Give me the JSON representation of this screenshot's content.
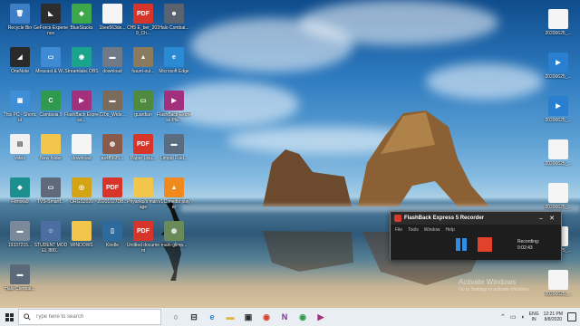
{
  "desktop": {
    "icons": [
      {
        "label": "Recycle Bin",
        "symbol": "🗑",
        "color": "#3d7fc6",
        "icon": "recycle-bin-icon"
      },
      {
        "label": "GeForce Experience",
        "symbol": "◣",
        "color": "#2d2d2d",
        "icon": "geforce-icon"
      },
      {
        "label": "BlueStacks",
        "symbol": "◆",
        "color": "#3ea74b",
        "icon": "bluestacks-icon"
      },
      {
        "label": "1bee563de...",
        "symbol": "",
        "color": "#f5f5f5",
        "icon": "file-icon"
      },
      {
        "label": "CH5 E_ber_2019_Ch...",
        "symbol": "PDF",
        "color": "#d7352a",
        "icon": "pdf-icon"
      },
      {
        "label": "Halo Combat...",
        "symbol": "☻",
        "color": "#5a6270",
        "icon": "game-icon"
      },
      {
        "label": "OneNote",
        "symbol": "◢",
        "color": "#2a2a2a",
        "icon": "onenote-icon"
      },
      {
        "label": "Miracast & W...",
        "symbol": "▭",
        "color": "#3e8bd3",
        "icon": "miracast-icon"
      },
      {
        "label": "Streamlabs OBS",
        "symbol": "◉",
        "color": "#1ca38d",
        "icon": "streamlabs-icon"
      },
      {
        "label": "download",
        "symbol": "▬",
        "color": "#6f7a86",
        "icon": "image-file-icon"
      },
      {
        "label": "haunt-out...",
        "symbol": "▲",
        "color": "#8a7b5f",
        "icon": "image-file-icon"
      },
      {
        "label": "Microsoft Edge",
        "symbol": "e",
        "color": "#2a8ad4",
        "icon": "edge-icon"
      },
      {
        "label": "This PC - Shortcut",
        "symbol": "▣",
        "color": "#3f8fd8",
        "icon": "this-pc-icon"
      },
      {
        "label": "Camtasia 9",
        "symbol": "C",
        "color": "#2f9a4d",
        "icon": "camtasia-icon"
      },
      {
        "label": "FlashBack Express...",
        "symbol": "▶",
        "color": "#a3307d",
        "icon": "flashback-icon"
      },
      {
        "label": "720p_Wide...",
        "symbol": "▬",
        "color": "#7a6b5b",
        "icon": "image-file-icon"
      },
      {
        "label": "guardian",
        "symbol": "▭",
        "color": "#4f8a3f",
        "icon": "image-file-icon"
      },
      {
        "label": "FlashBack Express Pla...",
        "symbol": "▶",
        "color": "#a3307d",
        "icon": "flashback-player-icon"
      },
      {
        "label": "video",
        "symbol": "▤",
        "color": "#f0f0f0",
        "icon": "video-file-icon"
      },
      {
        "label": "New folder",
        "symbol": "",
        "color": "#f2c64a",
        "icon": "folder-icon"
      },
      {
        "label": "download",
        "symbol": "",
        "color": "#f5f5f5",
        "icon": "file-icon"
      },
      {
        "label": "as4ff96f5...",
        "symbol": "◍",
        "color": "#8a5b4a",
        "icon": "image-file-icon"
      },
      {
        "label": "Paper Lipu...",
        "symbol": "PDF",
        "color": "#d7352a",
        "icon": "pdf-icon"
      },
      {
        "label": "Limpid Fuel...",
        "symbol": "▬",
        "color": "#5a6c80",
        "icon": "image-file-icon"
      },
      {
        "label": "Filmora9",
        "symbol": "◆",
        "color": "#1d8f8f",
        "icon": "filmora-icon"
      },
      {
        "label": "TVS-Smartf...",
        "symbol": "▭",
        "color": "#5e6a7a",
        "icon": "image-file-icon"
      },
      {
        "label": "ORGS2020",
        "symbol": "◎",
        "color": "#d4a416",
        "icon": "image-file-icon"
      },
      {
        "label": "20201027DB...",
        "symbol": "PDF",
        "color": "#d7352a",
        "icon": "pdf-icon"
      },
      {
        "label": "Priyanka's marriage",
        "symbol": "",
        "color": "#f2c64a",
        "icon": "folder-icon"
      },
      {
        "label": "VLC media player",
        "symbol": "▲",
        "color": "#f08a1c",
        "icon": "vlc-icon"
      },
      {
        "label": "19337215...",
        "symbol": "▬",
        "color": "#7a8a9a",
        "icon": "image-file-icon"
      },
      {
        "label": "STUDENT MODEL 880...",
        "symbol": "☺",
        "color": "#4a6fa0",
        "icon": "image-file-icon"
      },
      {
        "label": "WINDOWS",
        "symbol": "",
        "color": "#f2c64a",
        "icon": "folder-icon"
      },
      {
        "label": "Kindle",
        "symbol": "▯",
        "color": "#2e6a9b",
        "icon": "kindle-icon"
      },
      {
        "label": "Untitled document",
        "symbol": "PDF",
        "color": "#d7352a",
        "icon": "pdf-icon"
      },
      {
        "label": "main-glimp...",
        "symbol": "◍",
        "color": "#6a8a5a",
        "icon": "image-file-icon"
      },
      {
        "label": "Halo Combat...",
        "symbol": "▬",
        "color": "#5a6a7a",
        "icon": "game-icon"
      },
      {
        "label": "20200625_...",
        "symbol": "",
        "color": "#f5f5f5",
        "icon": "file-icon"
      },
      {
        "label": "20200625_...",
        "symbol": "▶",
        "color": "#2a7fd0",
        "icon": "video-file-icon"
      },
      {
        "label": "20200625_...",
        "symbol": "▶",
        "color": "#2a7fd0",
        "icon": "video-file-icon"
      },
      {
        "label": "20200625_...",
        "symbol": "",
        "color": "#f5f5f5",
        "icon": "file-icon"
      },
      {
        "label": "20200625_...",
        "symbol": "",
        "color": "#f5f5f5",
        "icon": "file-icon"
      },
      {
        "label": "20200625_...",
        "symbol": "",
        "color": "#f5f5f5",
        "icon": "file-icon"
      },
      {
        "label": "20200625_...",
        "symbol": "",
        "color": "#f5f5f5",
        "icon": "file-icon"
      }
    ]
  },
  "recorder": {
    "title": "FlashBack Express 5 Recorder",
    "minimize": "–",
    "close": "✕",
    "menu": [
      "File",
      "Tools",
      "Window",
      "Help"
    ],
    "status_label": "Recording:",
    "elapsed": "0:02:43",
    "pause_color": "#2f8de4",
    "stop_color": "#e2412c"
  },
  "watermark": {
    "line1": "Activate Windows",
    "line2": "Go to Settings to activate Windows."
  },
  "taskbar": {
    "search_placeholder": "Type here to search",
    "apps": [
      {
        "name": "task-view",
        "symbol": "○",
        "color": "#333333"
      },
      {
        "name": "task-view-icon2",
        "symbol": "⊟",
        "color": "#333333"
      },
      {
        "name": "edge",
        "symbol": "e",
        "color": "#1f7ad3"
      },
      {
        "name": "file-explorer",
        "symbol": "▬",
        "color": "#e3b235"
      },
      {
        "name": "store",
        "symbol": "▣",
        "color": "#2b2b2b"
      },
      {
        "name": "chrome",
        "symbol": "◉",
        "color": "#d9402c"
      },
      {
        "name": "onenote",
        "symbol": "N",
        "color": "#7c2f9e"
      },
      {
        "name": "chrome-2",
        "symbol": "◉",
        "color": "#2f9a4d"
      },
      {
        "name": "flashback",
        "symbol": "▶",
        "color": "#a3307d"
      }
    ],
    "lang_line1": "ENG",
    "lang_line2": "IN",
    "time": "12:21 PM",
    "date": "8/8/2020"
  }
}
